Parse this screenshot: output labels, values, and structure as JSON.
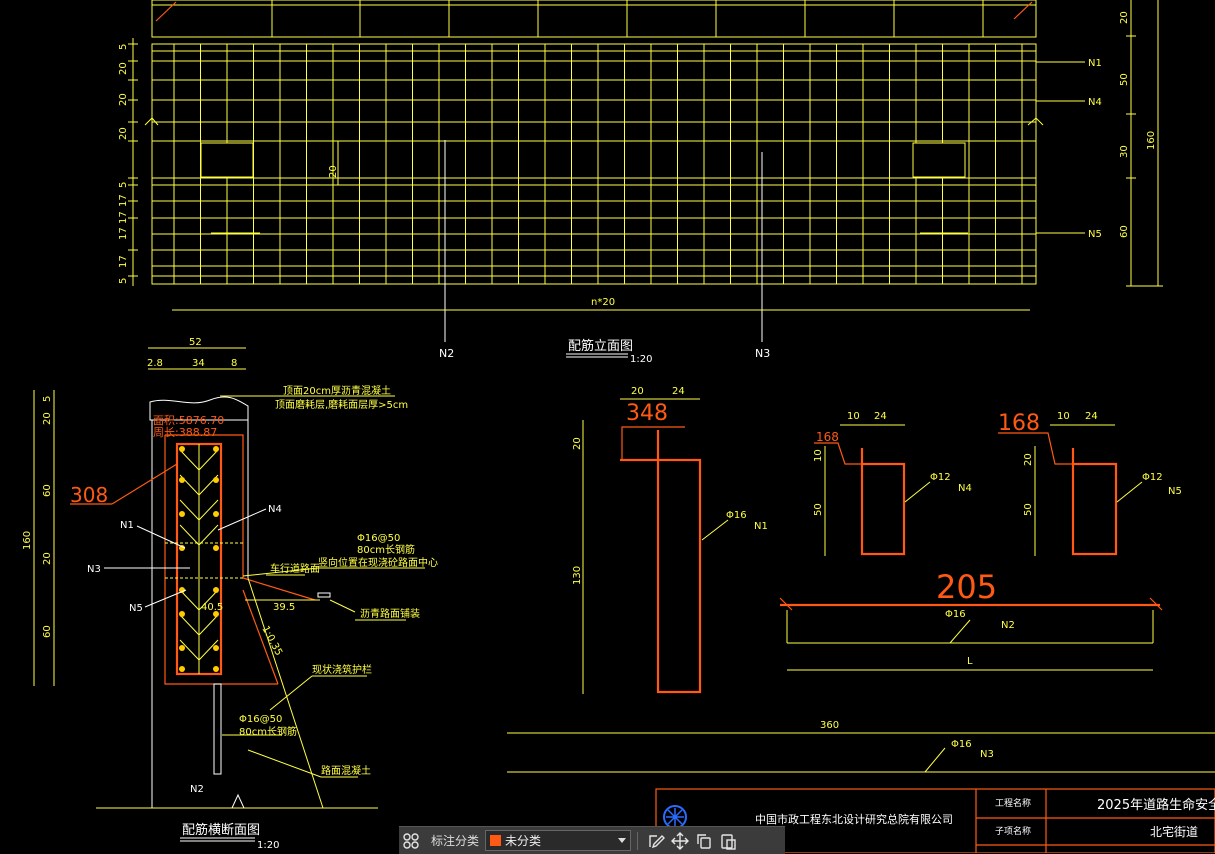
{
  "drawing": {
    "elevation_view_title": "配筋立面图",
    "elevation_scale": "1:20",
    "section_view_title": "配筋横断面图",
    "section_scale": "1:20",
    "elevation": {
      "dims_left": [
        "5",
        "20",
        "20",
        "20",
        "5",
        "17",
        "17",
        "17",
        "17",
        "5"
      ],
      "dims_right_inner": [
        "20",
        "50",
        "30",
        "60"
      ],
      "dims_right_outer": "160",
      "callouts": [
        "N1",
        "N4",
        "N5"
      ],
      "bottom_markers": [
        "N2",
        "N3"
      ],
      "length_label": "n*20",
      "small_dim": "20"
    },
    "section": {
      "top_dims": {
        "total": "52",
        "parts": [
          "2.8",
          "34",
          "8"
        ]
      },
      "left_dims": [
        "5",
        "20",
        "60",
        "20",
        "60"
      ],
      "overall_height": "160",
      "area_label": "面积:5876.70",
      "perimeter_label": "周长:388.87",
      "big_label": "308",
      "callouts": [
        "N1",
        "N3",
        "N5",
        "N4",
        "N2"
      ],
      "note_top_1": "顶面20cm厚沥青混凝土",
      "note_top_2": "顶面磨耗层,磨耗面层厚>5cm",
      "rebar_spec_1": "Φ16@50",
      "rebar_spec_2": "80cm长钢筋",
      "rebar_note": "竖向位置在现浇砼路面中心",
      "road_label": "车行道路面",
      "dim_a": "40.5",
      "dim_b": "39.5",
      "slope": "1:0.35",
      "layer_1": "沥青路面铺装",
      "layer_2": "现状浇筑护栏",
      "layer_3": "路面混凝土",
      "bottom_spec_1": "Φ16@50",
      "bottom_spec_2": "80cm长钢筋"
    },
    "bars": {
      "n1": {
        "big": "348",
        "top_dims": [
          "20",
          "24"
        ],
        "left_dims": [
          "20",
          "130"
        ],
        "spec": "Φ16",
        "id": "N1"
      },
      "n4": {
        "big": "168",
        "top_dims": [
          "10",
          "24"
        ],
        "left_dims": [
          "10",
          "50"
        ],
        "spec": "Φ12",
        "id": "N4"
      },
      "n5": {
        "big": "168",
        "top_dims": [
          "10",
          "24"
        ],
        "left_dims": [
          "20",
          "50"
        ],
        "spec": "Φ12",
        "id": "N5"
      },
      "n2": {
        "big": "205",
        "spec": "Φ16",
        "id": "N2",
        "len": "L"
      },
      "n3": {
        "len": "360",
        "spec": "Φ16",
        "id": "N3"
      }
    },
    "title_block": {
      "company": "中国市政工程东北设计研究总院有限公司",
      "project_label": "工程名称",
      "project_value": "2025年道路生命安全防护",
      "sub_label": "子项名称",
      "sub_value": "北宅街道"
    }
  },
  "toolbar": {
    "label": "标注分类",
    "selected": "未分类",
    "accent": "#ff5a14",
    "icons": [
      "grid-icon",
      "edit-icon",
      "move-icon",
      "copy-icon",
      "paste-icon"
    ]
  }
}
